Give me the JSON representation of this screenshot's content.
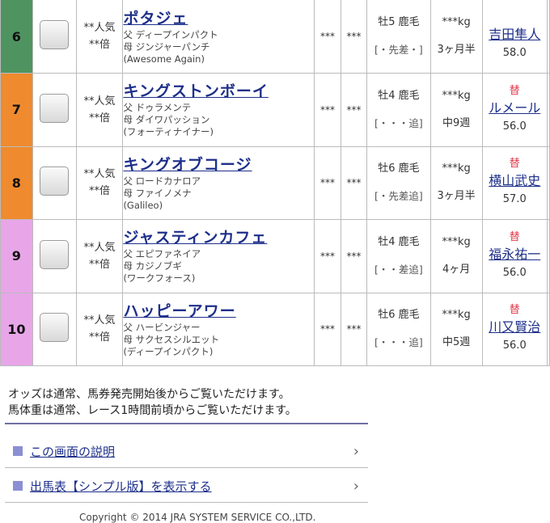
{
  "entries": [
    {
      "number": "6",
      "frame_color": "#4f9460",
      "popularity": "**人気",
      "odds_multiplier": "**倍",
      "horse_name": "ポタジェ",
      "sire": "父 ディープインパクト",
      "dam": "母 ジンジャーパンチ",
      "broodmare_sire": "(Awesome Again)",
      "odds_a": "***",
      "odds_b": "***",
      "sex_age_color": "牡5 鹿毛",
      "running_style": "[・先差・]",
      "weight": "***kg",
      "interval": "3ヶ月半",
      "substitute": "",
      "jockey": "吉田隼人",
      "jockey_weight": "58.0"
    },
    {
      "number": "7",
      "frame_color": "#ef8a2e",
      "popularity": "**人気",
      "odds_multiplier": "**倍",
      "horse_name": "キングストンボーイ",
      "sire": "父 ドゥラメンテ",
      "dam": "母 ダイワパッション",
      "broodmare_sire": "(フォーティナイナー)",
      "odds_a": "***",
      "odds_b": "***",
      "sex_age_color": "牡4 鹿毛",
      "running_style": "[・・・追]",
      "weight": "***kg",
      "interval": "中9週",
      "substitute": "替",
      "jockey": "ルメール",
      "jockey_weight": "56.0"
    },
    {
      "number": "8",
      "frame_color": "#ef8a2e",
      "popularity": "**人気",
      "odds_multiplier": "**倍",
      "horse_name": "キングオブコージ",
      "sire": "父 ロードカナロア",
      "dam": "母 ファイノメナ",
      "broodmare_sire": "(Galileo)",
      "odds_a": "***",
      "odds_b": "***",
      "sex_age_color": "牡6 鹿毛",
      "running_style": "[・先差追]",
      "weight": "***kg",
      "interval": "3ヶ月半",
      "substitute": "替",
      "jockey": "横山武史",
      "jockey_weight": "57.0"
    },
    {
      "number": "9",
      "frame_color": "#e8a6e8",
      "popularity": "**人気",
      "odds_multiplier": "**倍",
      "horse_name": "ジャスティンカフェ",
      "sire": "父 エピファネイア",
      "dam": "母 カジノブギ",
      "broodmare_sire": "(ワークフォース)",
      "odds_a": "***",
      "odds_b": "***",
      "sex_age_color": "牡4 鹿毛",
      "running_style": "[・・差追]",
      "weight": "***kg",
      "interval": "4ヶ月",
      "substitute": "替",
      "jockey": "福永祐一",
      "jockey_weight": "56.0"
    },
    {
      "number": "10",
      "frame_color": "#e8a6e8",
      "popularity": "**人気",
      "odds_multiplier": "**倍",
      "horse_name": "ハッピーアワー",
      "sire": "父 ハービンジャー",
      "dam": "母 サクセスシルエット",
      "broodmare_sire": "(ディープインパクト)",
      "odds_a": "***",
      "odds_b": "***",
      "sex_age_color": "牡6 鹿毛",
      "running_style": "[・・・追]",
      "weight": "***kg",
      "interval": "中5週",
      "substitute": "替",
      "jockey": "川又賢治",
      "jockey_weight": "56.0"
    }
  ],
  "notes": {
    "line1": "オッズは通常、馬券発売開始後からご覧いただけます。",
    "line2": "馬体重は通常、レース1時間前頃からご覧いただけます。"
  },
  "links": {
    "explain": "この画面の説明",
    "simple": "出馬表【シンプル版】を表示する"
  },
  "footer": {
    "copyright": "Copyright © 2014 JRA SYSTEM SERVICE CO.,LTD."
  }
}
